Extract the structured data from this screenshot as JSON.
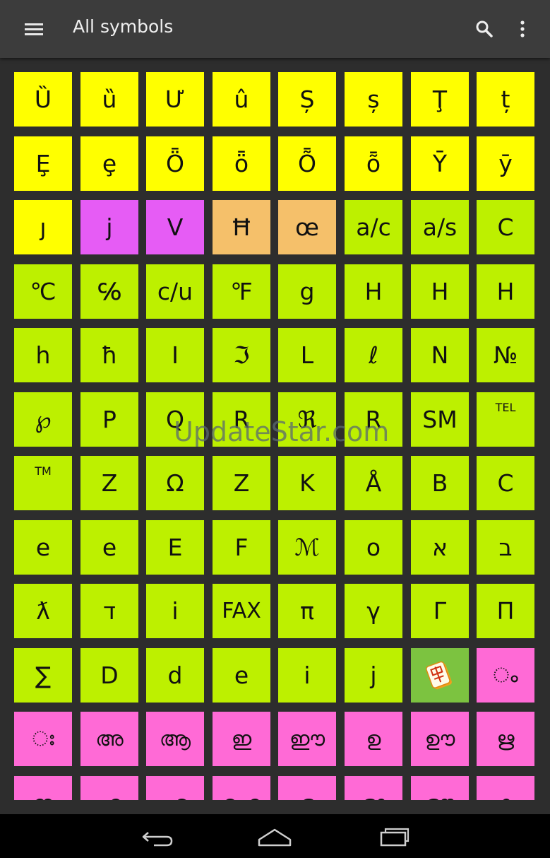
{
  "app": {
    "title": "All symbols"
  },
  "toolbar": {
    "menu_icon": "hamburger-menu-icon",
    "search_icon": "search-icon",
    "overflow_icon": "more-vertical-icon"
  },
  "colors": {
    "appbar": "#3c3c3c",
    "background": "#2d2d2d",
    "yellow": "#ffff00",
    "green": "#bdf000",
    "violet": "#e65cf5",
    "orange": "#f5c06a",
    "pink": "#ff6ad6",
    "icon_tile": "#7cc340"
  },
  "grid": {
    "rows": [
      {
        "tiles": [
          {
            "label": "Ȕ",
            "color": "yellow"
          },
          {
            "label": "ȕ",
            "color": "yellow"
          },
          {
            "label": "Ư",
            "color": "yellow"
          },
          {
            "label": "û",
            "color": "yellow"
          },
          {
            "label": "Ș",
            "color": "yellow"
          },
          {
            "label": "ș",
            "color": "yellow"
          },
          {
            "label": "Ţ",
            "color": "yellow"
          },
          {
            "label": "ț",
            "color": "yellow"
          }
        ]
      },
      {
        "tiles": [
          {
            "label": "Ȩ",
            "color": "yellow"
          },
          {
            "label": "ȩ",
            "color": "yellow"
          },
          {
            "label": "Ȫ",
            "color": "yellow"
          },
          {
            "label": "ȫ",
            "color": "yellow"
          },
          {
            "label": "Ȭ",
            "color": "yellow"
          },
          {
            "label": "ȭ",
            "color": "yellow"
          },
          {
            "label": "Ȳ",
            "color": "yellow"
          },
          {
            "label": "ȳ",
            "color": "yellow"
          }
        ]
      },
      {
        "tiles": [
          {
            "label": "ȷ",
            "color": "yellow"
          },
          {
            "label": "j",
            "color": "violet"
          },
          {
            "label": "V",
            "color": "violet"
          },
          {
            "label": "Ħ",
            "color": "orange"
          },
          {
            "label": "œ",
            "color": "orange"
          },
          {
            "label": "a/c",
            "color": "green"
          },
          {
            "label": "a/s",
            "color": "green"
          },
          {
            "label": "C",
            "color": "green"
          }
        ]
      },
      {
        "tiles": [
          {
            "label": "℃",
            "color": "green"
          },
          {
            "label": "℅",
            "color": "green"
          },
          {
            "label": "c/u",
            "color": "green"
          },
          {
            "label": "℉",
            "color": "green"
          },
          {
            "label": "g",
            "color": "green"
          },
          {
            "label": "H",
            "color": "green"
          },
          {
            "label": "H",
            "color": "green"
          },
          {
            "label": "H",
            "color": "green"
          }
        ]
      },
      {
        "tiles": [
          {
            "label": "h",
            "color": "green"
          },
          {
            "label": "ħ",
            "color": "green"
          },
          {
            "label": "I",
            "color": "green"
          },
          {
            "label": "ℑ",
            "color": "green"
          },
          {
            "label": "L",
            "color": "green"
          },
          {
            "label": "ℓ",
            "color": "green"
          },
          {
            "label": "N",
            "color": "green"
          },
          {
            "label": "№",
            "color": "green"
          }
        ]
      },
      {
        "tiles": [
          {
            "label": "℘",
            "color": "green"
          },
          {
            "label": "P",
            "color": "green"
          },
          {
            "label": "Q",
            "color": "green"
          },
          {
            "label": "R",
            "color": "green"
          },
          {
            "label": "ℜ",
            "color": "green"
          },
          {
            "label": "R",
            "color": "green"
          },
          {
            "label": "SM",
            "color": "green"
          },
          {
            "label": "TEL",
            "color": "green",
            "small": true
          }
        ]
      },
      {
        "tiles": [
          {
            "label": "TM",
            "color": "green",
            "small": true
          },
          {
            "label": "Z",
            "color": "green"
          },
          {
            "label": "Ω",
            "color": "green"
          },
          {
            "label": "Z",
            "color": "green"
          },
          {
            "label": "K",
            "color": "green"
          },
          {
            "label": "Å",
            "color": "green"
          },
          {
            "label": "B",
            "color": "green"
          },
          {
            "label": "C",
            "color": "green"
          }
        ]
      },
      {
        "tiles": [
          {
            "label": "e",
            "color": "green"
          },
          {
            "label": "e",
            "color": "green"
          },
          {
            "label": "E",
            "color": "green"
          },
          {
            "label": "F",
            "color": "green"
          },
          {
            "label": "ℳ",
            "color": "green"
          },
          {
            "label": "o",
            "color": "green"
          },
          {
            "label": "א",
            "color": "green"
          },
          {
            "label": "ב",
            "color": "green"
          }
        ]
      },
      {
        "tiles": [
          {
            "label": "ƛ",
            "color": "green"
          },
          {
            "label": "ד",
            "color": "green"
          },
          {
            "label": "i",
            "color": "green"
          },
          {
            "label": "FAX",
            "color": "green",
            "tight": true
          },
          {
            "label": "π",
            "color": "green"
          },
          {
            "label": "γ",
            "color": "green"
          },
          {
            "label": "Γ",
            "color": "green"
          },
          {
            "label": "Π",
            "color": "green"
          }
        ]
      },
      {
        "tiles": [
          {
            "label": "∑",
            "color": "green"
          },
          {
            "label": "D",
            "color": "green"
          },
          {
            "label": "d",
            "color": "green"
          },
          {
            "label": "e",
            "color": "green"
          },
          {
            "label": "i",
            "color": "green"
          },
          {
            "label": "j",
            "color": "green"
          },
          {
            "label": "",
            "color": "icon_tile",
            "icon": "mahjong-tile-icon"
          },
          {
            "label": "ം",
            "color": "pink",
            "mal": true
          }
        ]
      },
      {
        "tiles": [
          {
            "label": "ഃ",
            "color": "pink",
            "mal": true
          },
          {
            "label": "അ",
            "color": "pink",
            "mal": true
          },
          {
            "label": "ആ",
            "color": "pink",
            "mal": true
          },
          {
            "label": "ഇ",
            "color": "pink",
            "mal": true
          },
          {
            "label": "ഈ",
            "color": "pink",
            "mal": true
          },
          {
            "label": "ഉ",
            "color": "pink",
            "mal": true
          },
          {
            "label": "ഊ",
            "color": "pink",
            "mal": true
          },
          {
            "label": "ഋ",
            "color": "pink",
            "mal": true
          }
        ]
      },
      {
        "tiles": [
          {
            "label": "ഌ",
            "color": "pink",
            "mal": true
          },
          {
            "label": "എ",
            "color": "pink",
            "mal": true
          },
          {
            "label": "ഏ",
            "color": "pink",
            "mal": true
          },
          {
            "label": "ഐ",
            "color": "pink",
            "mal": true
          },
          {
            "label": "ഒ",
            "color": "pink",
            "mal": true
          },
          {
            "label": "ഓ",
            "color": "pink",
            "mal": true
          },
          {
            "label": "ഔ",
            "color": "pink",
            "mal": true
          },
          {
            "label": "ക",
            "color": "pink",
            "mal": true
          }
        ]
      }
    ]
  },
  "watermark": "UpdateStar.com",
  "navigation": {
    "back_icon": "back-arrow-icon",
    "home_icon": "home-icon",
    "recents_icon": "recent-apps-icon"
  }
}
